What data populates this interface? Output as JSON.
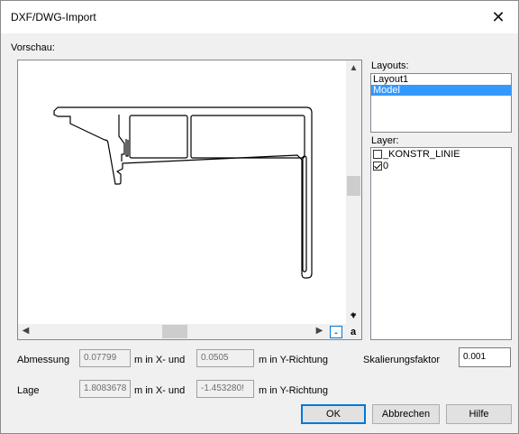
{
  "window": {
    "title": "DXF/DWG-Import",
    "close_glyph": "✕"
  },
  "preview": {
    "label": "Vorschau:",
    "zoom_in": "+",
    "zoom_out": "-",
    "zoom_fit": "a"
  },
  "layouts": {
    "label": "Layouts:",
    "items": [
      {
        "label": "Layout1"
      },
      {
        "label": "Model"
      }
    ],
    "selected": "Model"
  },
  "layers": {
    "label": "Layer:",
    "items": [
      {
        "label": "_KONSTR_LINIE",
        "checked": false
      },
      {
        "label": "0",
        "checked": true
      }
    ]
  },
  "abmessung": {
    "label": "Abmessung",
    "x_value": "0.07799",
    "x_unit": "m  in X- und",
    "y_value": "0.0505",
    "y_unit": "m  in Y-Richtung"
  },
  "lage": {
    "label": "Lage",
    "x_value": "1.8083678",
    "x_unit": "m  in X- und",
    "y_value": "-1.453280!",
    "y_unit": "m  in Y-Richtung"
  },
  "scale": {
    "label": "Skalierungsfaktor",
    "value": "0.001"
  },
  "buttons": {
    "ok": "OK",
    "cancel": "Abbrechen",
    "help": "Hilfe"
  },
  "colors": {
    "selection": "#3399ff",
    "default_button_border": "#0078d7"
  }
}
